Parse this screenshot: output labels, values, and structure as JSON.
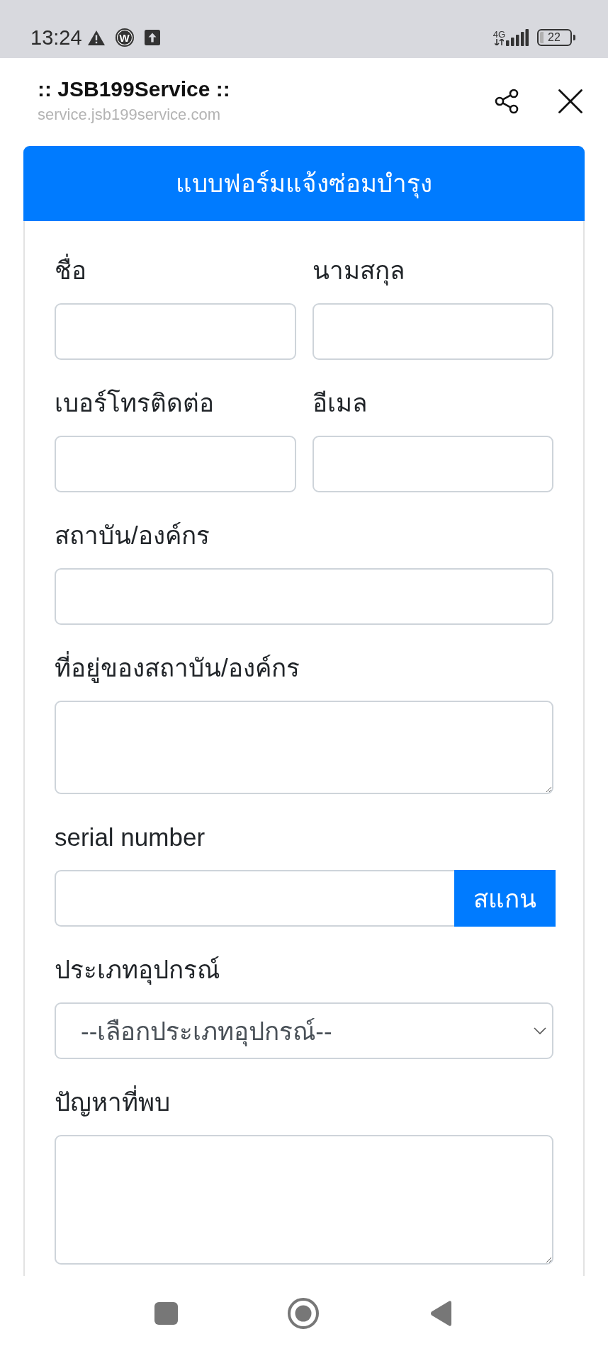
{
  "status_bar": {
    "time": "13:24",
    "notifications": [
      {
        "kind": "warning"
      },
      {
        "kind": "app",
        "letter": "W"
      },
      {
        "kind": "upload"
      }
    ],
    "network": "4G",
    "battery": "22"
  },
  "browser_bar": {
    "title": ":: JSB199Service ::",
    "url": "service.jsb199service.com",
    "actions": [
      {
        "kind": "share"
      },
      {
        "kind": "close"
      }
    ]
  },
  "form": {
    "title": "แบบฟอร์มแจ้งซ่อมบำรุง",
    "rows": [
      [
        {
          "kind": "input",
          "label": "ชื่อ"
        },
        {
          "kind": "input",
          "label": "นามสกุล"
        }
      ],
      [
        {
          "kind": "input",
          "label": "เบอร์โทรติดต่อ"
        },
        {
          "kind": "input",
          "label": "อีเมล"
        }
      ],
      [
        {
          "kind": "input",
          "label": "สถาบัน/องค์กร"
        }
      ],
      [
        {
          "kind": "short_textarea",
          "label": "ที่อยู่ของสถาบัน/องค์กร"
        }
      ],
      [
        {
          "kind": "scan",
          "label": "serial number",
          "button": "สแกน"
        }
      ],
      [
        {
          "kind": "select",
          "label": "ประเภทอุปกรณ์",
          "value": "--เลือกประเภทอุปกรณ์--"
        }
      ],
      [
        {
          "kind": "textarea",
          "label": "ปัญหาที่พบ"
        }
      ]
    ]
  },
  "nav_bar": [
    {
      "kind": "recents"
    },
    {
      "kind": "home"
    },
    {
      "kind": "back"
    }
  ]
}
